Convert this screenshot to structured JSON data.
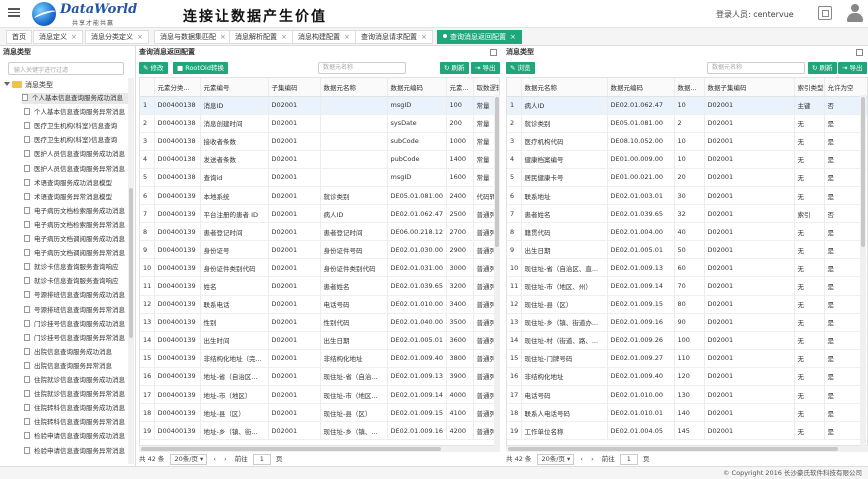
{
  "header": {
    "logo_name": "DataWorld",
    "logo_sub": "共享才能共赢",
    "slogan": "连接让数据产生价值",
    "login_label": "登录人员: centervue"
  },
  "tabs": [
    {
      "label": "首页"
    },
    {
      "label": "消息定义"
    },
    {
      "label": "消息分类定义"
    },
    {
      "label": "消息与数据集匹配"
    },
    {
      "label": "消息解析配置"
    },
    {
      "label": "消息构建配置"
    },
    {
      "label": "查询消息请求配置"
    },
    {
      "label": "查询消息返回配置"
    }
  ],
  "left": {
    "title": "消息类型",
    "search_placeholder": "输入关键字进行过滤",
    "root_label": "消息类型",
    "items": [
      "个人基本信息查询服务成功消息",
      "个人基本信息查询服务异常消息",
      "医疗卫生机构(科室)信息查询",
      "医疗卫生机构(科室)信息查询",
      "医护人员信息查询服务成功消息",
      "医护人员信息查询服务异常消息",
      "术语查询服务成功消息模型",
      "术语查询服务异常消息模型",
      "电子病历文档检索服务成功消息",
      "电子病历文档检索服务异常消息",
      "电子病历文档调阅服务成功消息",
      "电子病历文档调阅服务异常消息",
      "就诊卡信息查询服务查询响应",
      "就诊卡信息查询服务查询响应",
      "号源排班信息查询服务成功消息",
      "号源排班信息查询服务异常消息",
      "门诊挂号信息查询服务成功消息",
      "门诊挂号信息查询服务异常消息",
      "出院信息查询服务成功消息",
      "出院信息查询服务异常消息",
      "住院就诊信息查询服务成功消息",
      "住院就诊信息查询服务异常消息",
      "住院转科信息查询服务成功消息",
      "住院转科信息查询服务异常消息",
      "检验申请信息查询服务成功消息",
      "检验申请信息查询服务异常消息"
    ]
  },
  "mid": {
    "title": "查询消息返回配置",
    "btn_edit": "修改",
    "btn_root": "RootOid转换",
    "filter_placeholder": "数据元名称",
    "btn_refresh": "刷新",
    "btn_export": "导出",
    "columns": [
      "",
      "元素分类...",
      "元素编号",
      "子集编码",
      "数据元名称",
      "数据元编码",
      "元素...",
      "取数逻辑"
    ],
    "rows": [
      [
        "1",
        "D00400138",
        "消息ID",
        "D02001",
        "",
        "msgID",
        "100",
        "常量"
      ],
      [
        "2",
        "D00400138",
        "消息创建时间",
        "D02001",
        "",
        "sysDate",
        "200",
        "常量"
      ],
      [
        "3",
        "D00400138",
        "接收者条数",
        "D02001",
        "",
        "subCode",
        "1000",
        "常量"
      ],
      [
        "4",
        "D00400138",
        "发送者条数",
        "D02001",
        "",
        "pubCode",
        "1400",
        "常量"
      ],
      [
        "5",
        "D00400138",
        "查询id",
        "D02001",
        "",
        "msgID",
        "1600",
        "常量"
      ],
      [
        "6",
        "D00400139",
        "本地系统",
        "D02001",
        "就诊类别",
        "DE05.01.081.00",
        "2400",
        "代码转"
      ],
      [
        "7",
        "D00400139",
        "平台注册的患者 ID",
        "D02001",
        "病人ID",
        "DE02.01.062.47",
        "2500",
        "普通列"
      ],
      [
        "8",
        "D00400139",
        "患者登记时间",
        "D02001",
        "患者登记时间",
        "DE06.00.218.12",
        "2700",
        "普通列"
      ],
      [
        "9",
        "D00400139",
        "身份证号",
        "D02001",
        "身份证件号码",
        "DE02.01.030.00",
        "2900",
        "普通列"
      ],
      [
        "10",
        "D00400139",
        "身份证件类别代码",
        "D02001",
        "身份证件类别代码",
        "DE02.01.031.00",
        "3000",
        "普通列"
      ],
      [
        "11",
        "D00400139",
        "姓名",
        "D02001",
        "患者姓名",
        "DE02.01.039.65",
        "3200",
        "普通列"
      ],
      [
        "12",
        "D00400139",
        "联系电话",
        "D02001",
        "电话号码",
        "DE02.01.010.00",
        "3400",
        "普通列"
      ],
      [
        "13",
        "D00400139",
        "性别",
        "D02001",
        "性别代码",
        "DE02.01.040.00",
        "3500",
        "普通列"
      ],
      [
        "14",
        "D00400139",
        "出生时间",
        "D02001",
        "出生日期",
        "DE02.01.005.01",
        "3600",
        "普通列"
      ],
      [
        "15",
        "D00400139",
        "非结构化地址（完...",
        "D02001",
        "非结构化地址",
        "DE02.01.009.40",
        "3800",
        "普通列"
      ],
      [
        "16",
        "D00400139",
        "地址-省（自治区...",
        "D02001",
        "现住址-省（自治...",
        "DE02.01.009.13",
        "3900",
        "普通列"
      ],
      [
        "17",
        "D00400139",
        "地址-市（地区）",
        "D02001",
        "现住址-市（地区...",
        "DE02.01.009.14",
        "4000",
        "普通列"
      ],
      [
        "18",
        "D00400139",
        "地址-县（区）",
        "D02001",
        "现住址-县（区）",
        "DE02.01.009.15",
        "4100",
        "普通列"
      ],
      [
        "19",
        "D00400139",
        "地址-乡（镇、街...",
        "D02001",
        "现住址-乡（镇、...",
        "DE02.01.009.16",
        "4200",
        "普通列"
      ]
    ],
    "pager": {
      "total": "共 42 条",
      "size": "20条/页",
      "goto": "前往",
      "page": "1",
      "unit": "页"
    }
  },
  "right": {
    "title": "消息类型",
    "btn_view": "浏览",
    "filter_placeholder": "数据元名称",
    "btn_refresh": "刷新",
    "btn_export": "导出",
    "columns": [
      "",
      "数据元名称",
      "数据元编码",
      "数据...",
      "数据子集编码",
      "索引类型...",
      "允许为空"
    ],
    "rows": [
      [
        "1",
        "病人ID",
        "DE02.01.062.47",
        "10",
        "D02001",
        "主键",
        "否"
      ],
      [
        "2",
        "就诊类别",
        "DE05.01.081.00",
        "2",
        "D02001",
        "无",
        "是"
      ],
      [
        "3",
        "医疗机构代码",
        "DE08.10.052.00",
        "10",
        "D02001",
        "无",
        "是"
      ],
      [
        "4",
        "健康档案编号",
        "DE01.00.009.00",
        "10",
        "D02001",
        "无",
        "是"
      ],
      [
        "5",
        "居民健康卡号",
        "DE01.00.021.00",
        "20",
        "D02001",
        "无",
        "是"
      ],
      [
        "6",
        "联系地址",
        "DE02.01.003.01",
        "30",
        "D02001",
        "无",
        "是"
      ],
      [
        "7",
        "患者姓名",
        "DE02.01.039.65",
        "32",
        "D02001",
        "索引",
        "否"
      ],
      [
        "8",
        "籍贯代码",
        "DE02.01.004.00",
        "40",
        "D02001",
        "无",
        "是"
      ],
      [
        "9",
        "出生日期",
        "DE02.01.005.01",
        "50",
        "D02001",
        "无",
        "是"
      ],
      [
        "10",
        "现住址-省（自治区、直...",
        "DE02.01.009.13",
        "60",
        "D02001",
        "无",
        "是"
      ],
      [
        "11",
        "现住址-市（地区、州）",
        "DE02.01.009.14",
        "70",
        "D02001",
        "无",
        "是"
      ],
      [
        "12",
        "现住址-县（区）",
        "DE02.01.009.15",
        "80",
        "D02001",
        "无",
        "是"
      ],
      [
        "13",
        "现住址-乡（镇、街道办...",
        "DE02.01.009.16",
        "90",
        "D02001",
        "无",
        "是"
      ],
      [
        "14",
        "现住址-村（街道、路、...",
        "DE02.01.009.26",
        "100",
        "D02001",
        "无",
        "是"
      ],
      [
        "15",
        "现住址-门牌号码",
        "DE02.01.009.27",
        "110",
        "D02001",
        "无",
        "是"
      ],
      [
        "16",
        "非结构化地址",
        "DE02.01.009.40",
        "120",
        "D02001",
        "无",
        "是"
      ],
      [
        "17",
        "电话号码",
        "DE02.01.010.00",
        "130",
        "D02001",
        "无",
        "是"
      ],
      [
        "18",
        "联系人电话号码",
        "DE02.01.010.01",
        "140",
        "D02001",
        "无",
        "是"
      ],
      [
        "19",
        "工作单位名称",
        "DE02.01.004.05",
        "145",
        "D02001",
        "无",
        "是"
      ]
    ],
    "pager": {
      "total": "共 42 条",
      "size": "20条/页",
      "goto": "前往",
      "page": "1",
      "unit": "页"
    }
  },
  "footer": {
    "copyright": "© Copyright 2016 长沙豪氏软件科技有限公司"
  }
}
